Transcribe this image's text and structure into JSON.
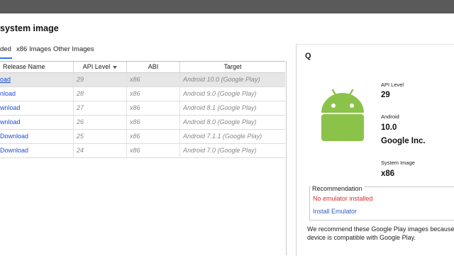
{
  "heading": "system image",
  "tabs": [
    {
      "label": "ded",
      "active": true
    },
    {
      "label": "x86 Images",
      "active": false
    },
    {
      "label": "Other Images",
      "active": false
    }
  ],
  "table": {
    "headers": [
      "Release Name",
      "API Level",
      "ABI",
      "Target"
    ],
    "rows": [
      {
        "release": "oad",
        "api": "29",
        "abi": "x86",
        "target": "Android 10.0 (Google Play)"
      },
      {
        "release": "nload",
        "api": "28",
        "abi": "x86",
        "target": "Android 9.0 (Google Play)"
      },
      {
        "release": "wnload",
        "api": "27",
        "abi": "x86",
        "target": "Android 8.1 (Google Play)"
      },
      {
        "release": "wnload",
        "api": "26",
        "abi": "x86",
        "target": "Android 8.0 (Google Play)"
      },
      {
        "release": "Download",
        "api": "25",
        "abi": "x86",
        "target": "Android 7.1.1 (Google Play)"
      },
      {
        "release": "Download",
        "api": "24",
        "abi": "x86",
        "target": "Android 7.0 (Google Play)"
      }
    ]
  },
  "details": {
    "title": "Q",
    "api_level_label": "API Level",
    "api_level_value": "29",
    "android_label": "Android",
    "android_value": "10.0",
    "vendor_value": "Google Inc.",
    "system_image_label": "System Image",
    "system_image_value": "x86",
    "recommendation_title": "Recommendation",
    "recommendation_warning": "No emulator installed",
    "install_link": "Install Emulator",
    "description_line1": "We recommend these Google Play images because t",
    "description_line2": "device is compatible with Google Play."
  },
  "colors": {
    "link": "#1d4fd1",
    "warning": "#d32f2f",
    "android_green": "#8bc34a",
    "tab_accent": "#3574f0"
  }
}
